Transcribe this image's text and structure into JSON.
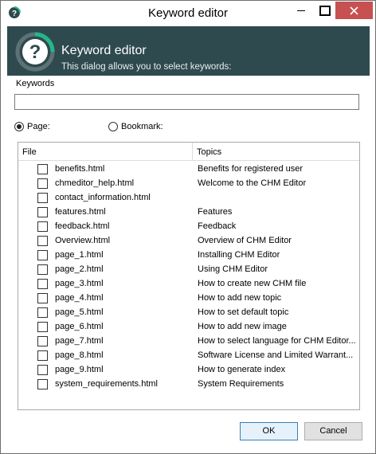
{
  "window": {
    "title": "Keyword editor"
  },
  "header": {
    "title": "Keyword editor",
    "subtitle": "This dialog allows you to select keywords:"
  },
  "keywords": {
    "label": "Keywords",
    "value": ""
  },
  "radios": {
    "page_label": "Page:",
    "bookmark_label": "Bookmark:",
    "selected": "page"
  },
  "list": {
    "columns": {
      "file": "File",
      "topics": "Topics"
    },
    "rows": [
      {
        "file": "benefits.html",
        "topic": "Benefits for registered user"
      },
      {
        "file": "chmeditor_help.html",
        "topic": "Welcome to the CHM Editor"
      },
      {
        "file": "contact_information.html",
        "topic": ""
      },
      {
        "file": "features.html",
        "topic": "Features"
      },
      {
        "file": "feedback.html",
        "topic": "Feedback"
      },
      {
        "file": "Overview.html",
        "topic": "Overview of CHM Editor"
      },
      {
        "file": "page_1.html",
        "topic": "Installing CHM Editor"
      },
      {
        "file": "page_2.html",
        "topic": "Using CHM Editor"
      },
      {
        "file": "page_3.html",
        "topic": "How to create new CHM file"
      },
      {
        "file": "page_4.html",
        "topic": "How to add new topic"
      },
      {
        "file": "page_5.html",
        "topic": "How to set default topic"
      },
      {
        "file": "page_6.html",
        "topic": "How to add new image"
      },
      {
        "file": "page_7.html",
        "topic": "How to select language for CHM Editor..."
      },
      {
        "file": "page_8.html",
        "topic": "Software License and Limited Warrant..."
      },
      {
        "file": "page_9.html",
        "topic": "How to generate index"
      },
      {
        "file": "system_requirements.html",
        "topic": "System Requirements"
      }
    ]
  },
  "buttons": {
    "ok": "OK",
    "cancel": "Cancel"
  },
  "colors": {
    "header_bg": "#2f4a4e",
    "accent": "#3c7fb1",
    "close_bg": "#c75050"
  },
  "icons": {
    "app": "help-question-icon",
    "header": "help-question-logo-icon"
  }
}
